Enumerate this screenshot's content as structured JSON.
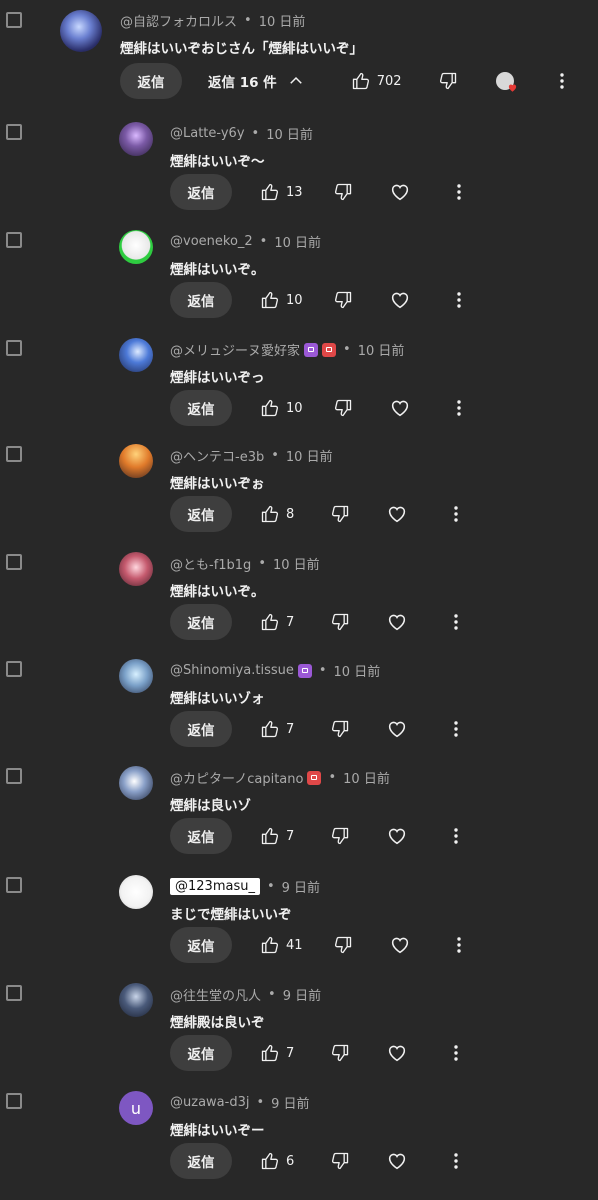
{
  "parent": {
    "author": "@自認フォカロルス",
    "time": "10 日前",
    "text": "煙緋はいいぞおじさん「煙緋はいいぞ」",
    "reply_label": "返信",
    "replies_toggle": "返信 16 件",
    "likes": "702"
  },
  "replies": [
    {
      "author": "@Latte-y6y",
      "time": "10 日前",
      "text": "煙緋はいいぞ〜",
      "likes": "13",
      "reply_label": "返信",
      "badges": []
    },
    {
      "author": "@voeneko_2",
      "time": "10 日前",
      "text": "煙緋はいいぞ。",
      "likes": "10",
      "reply_label": "返信",
      "badges": []
    },
    {
      "author": "@メリュジーヌ愛好家",
      "time": "10 日前",
      "text": "煙緋はいいぞっ",
      "likes": "10",
      "reply_label": "返信",
      "badges": [
        "purple",
        "red"
      ]
    },
    {
      "author": "@ヘンテコ-e3b",
      "time": "10 日前",
      "text": "煙緋はいいぞぉ",
      "likes": "8",
      "reply_label": "返信",
      "badges": []
    },
    {
      "author": "@とも-f1b1g",
      "time": "10 日前",
      "text": "煙緋はいいぞ。",
      "likes": "7",
      "reply_label": "返信",
      "badges": []
    },
    {
      "author": "@Shinomiya.tissue",
      "time": "10 日前",
      "text": "煙緋はいいゾォ",
      "likes": "7",
      "reply_label": "返信",
      "badges": [
        "purple"
      ]
    },
    {
      "author": "@カピターノcapitano",
      "time": "10 日前",
      "text": "煙緋は良いゾ",
      "likes": "7",
      "reply_label": "返信",
      "badges": [
        "red"
      ]
    },
    {
      "author": "@123masu_",
      "time": "9 日前",
      "text": "まじで煙緋はいいぞ",
      "likes": "41",
      "reply_label": "返信",
      "badges": []
    },
    {
      "author": "@往生堂の凡人",
      "time": "9 日前",
      "text": "煙緋殿は良いぞ",
      "likes": "7",
      "reply_label": "返信",
      "badges": []
    },
    {
      "author": "@uzawa-d3j",
      "time": "9 日前",
      "text": "煙緋はいいぞー",
      "likes": "6",
      "reply_label": "返信",
      "badges": [],
      "avatar_letter": "u"
    }
  ],
  "icons": {
    "like": "thumbs-up-icon",
    "dislike": "thumbs-down-icon",
    "heart": "heart-icon",
    "more": "more-vert-icon",
    "chevron": "chevron-up-icon"
  },
  "colors": {
    "background": "#282828",
    "button": "#3e3e3e",
    "text": "#f1f1f1",
    "meta": "#aaaaaa"
  }
}
